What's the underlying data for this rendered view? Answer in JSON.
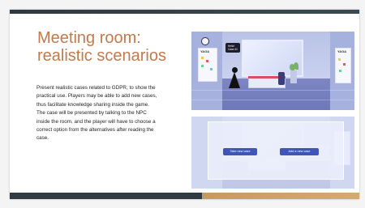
{
  "slide": {
    "title_lines": [
      "Meeting room:",
      "realistic scenarios"
    ],
    "body_lines": [
      "Present realistic cases related to GDPR, to show the",
      "practical use. Players may be able to add new cases,",
      "thus facilitate knowledge sharing inside the game.",
      "The case will be presented by talking to the NPC",
      "inside the room, and the player will have to choose a",
      "correct option from the alternatives after reading the",
      "case."
    ]
  },
  "scene_top": {
    "whiteboard_text": "YAGA",
    "right_board_text": "YAGA",
    "npc_bubble_lines": [
      "Hello!",
      "Case #1"
    ]
  },
  "scene_bottom": {
    "take_case_label": "Take new case",
    "add_case_label": "Add a new case"
  },
  "colors": {
    "title": "#c07a4d",
    "accent_dark": "#2f3b41",
    "accent_gold": "#d2ab74",
    "game_button": "#3f55b8"
  }
}
